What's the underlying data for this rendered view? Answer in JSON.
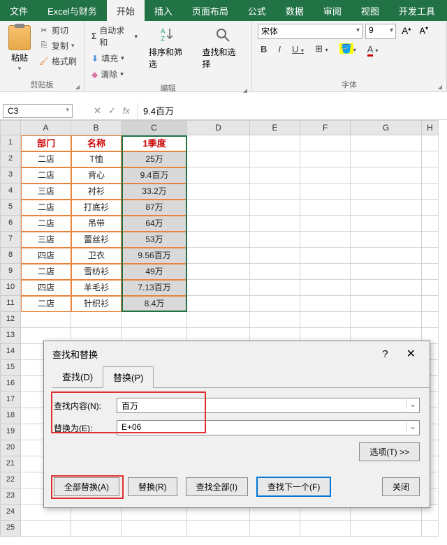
{
  "tabs": [
    "文件",
    "Excel与财务",
    "开始",
    "插入",
    "页面布局",
    "公式",
    "数据",
    "审阅",
    "视图",
    "开发工具"
  ],
  "activeTab": 2,
  "clipboard": {
    "paste": "粘贴",
    "cut": "剪切",
    "copy": "复制",
    "format": "格式刷",
    "label": "剪贴板"
  },
  "edit": {
    "sum": "自动求和",
    "fill": "填充",
    "clear": "清除",
    "sort": "排序和筛选",
    "find": "查找和选择",
    "label": "编辑"
  },
  "font": {
    "family": "宋体",
    "size": "9",
    "bold": "B",
    "italic": "I",
    "underline": "U",
    "label": "字体"
  },
  "nameBox": "C3",
  "formula": "9.4百万",
  "cols": [
    "A",
    "B",
    "C",
    "D",
    "E",
    "F",
    "G",
    "H"
  ],
  "headers": [
    "部门",
    "名称",
    "1季度"
  ],
  "rows": [
    {
      "n": 2,
      "a": "二店",
      "b": "T恤",
      "c": "25万"
    },
    {
      "n": 3,
      "a": "二店",
      "b": "背心",
      "c": "9.4百万"
    },
    {
      "n": 4,
      "a": "三店",
      "b": "衬衫",
      "c": "33.2万"
    },
    {
      "n": 5,
      "a": "二店",
      "b": "打底衫",
      "c": "87万"
    },
    {
      "n": 6,
      "a": "二店",
      "b": "吊带",
      "c": "64万"
    },
    {
      "n": 7,
      "a": "三店",
      "b": "蕾丝衫",
      "c": "53万"
    },
    {
      "n": 8,
      "a": "四店",
      "b": "卫衣",
      "c": "9.56百万"
    },
    {
      "n": 9,
      "a": "二店",
      "b": "雪纺衫",
      "c": "49万"
    },
    {
      "n": 10,
      "a": "四店",
      "b": "羊毛衫",
      "c": "7.13百万"
    },
    {
      "n": 11,
      "a": "二店",
      "b": "针织衫",
      "c": "8.4万"
    }
  ],
  "emptyRows": [
    12,
    13,
    14,
    15,
    16,
    17,
    18,
    19,
    20,
    21,
    22,
    23,
    24,
    25
  ],
  "dialog": {
    "title": "查找和替换",
    "tab_find": "查找(D)",
    "tab_replace": "替换(P)",
    "find_label": "查找内容(N):",
    "find_value": "百万",
    "replace_label": "替换为(E):",
    "replace_value": "E+06",
    "options": "选项(T) >>",
    "replace_all": "全部替换(A)",
    "replace_btn": "替换(R)",
    "find_all": "查找全部(I)",
    "find_next": "查找下一个(F)",
    "close": "关闭"
  }
}
